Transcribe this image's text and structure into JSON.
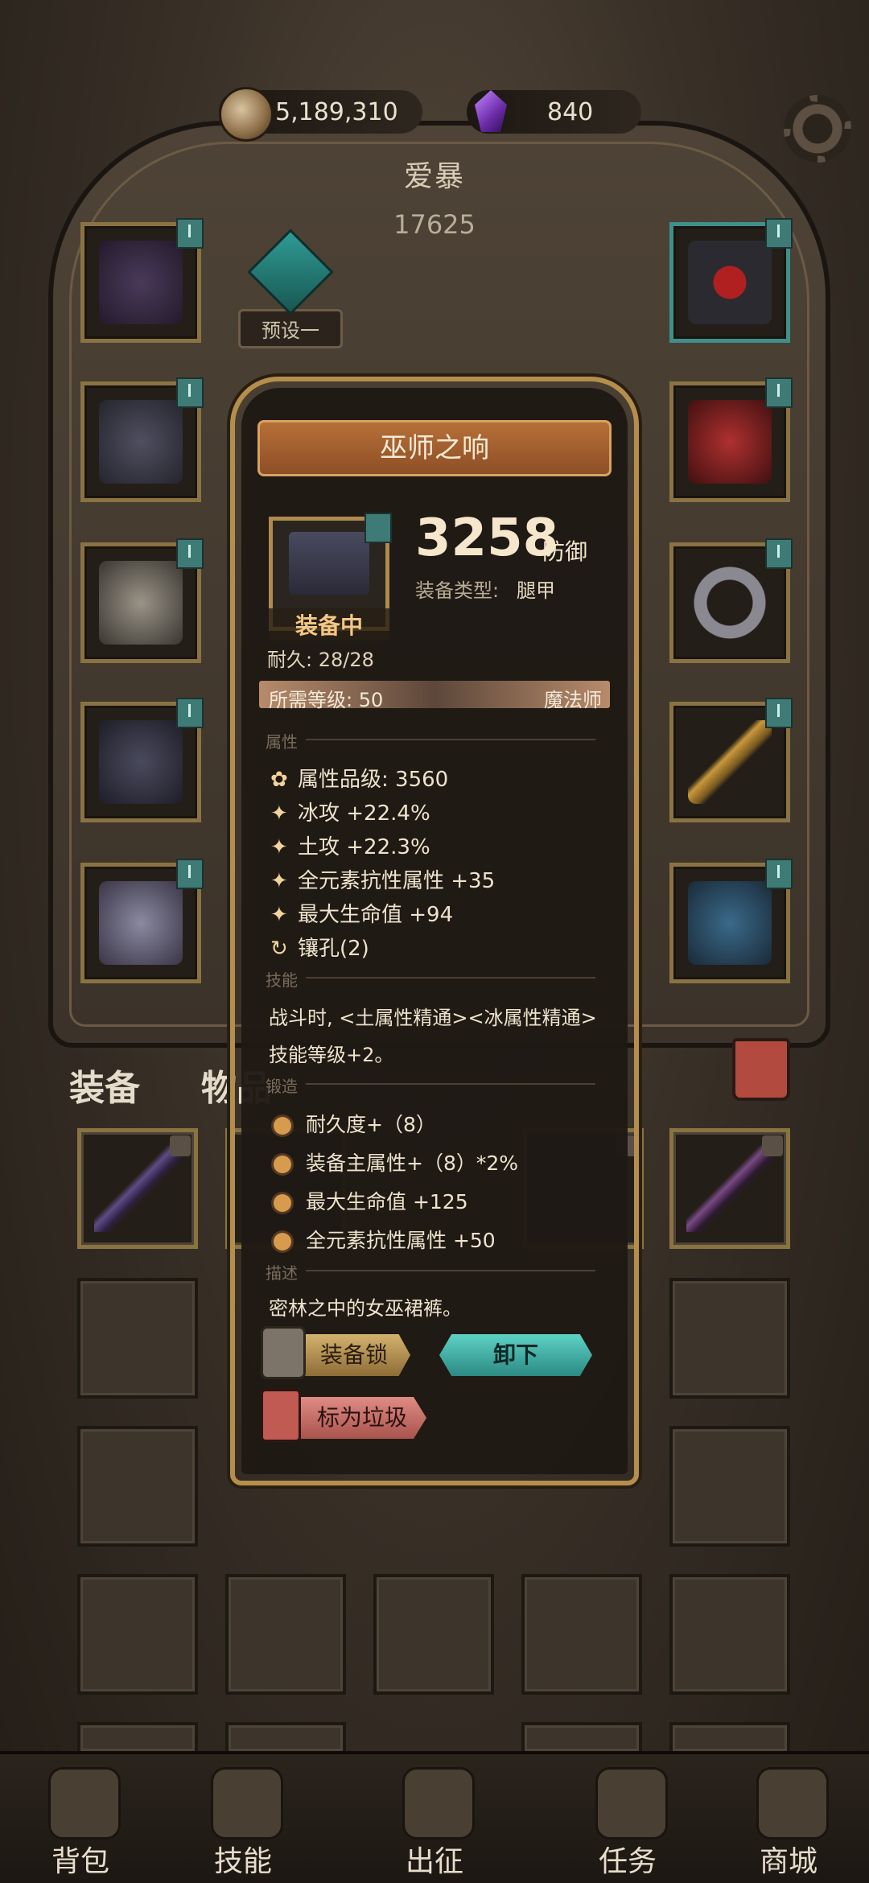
{
  "currency": {
    "gold": "5,189,310",
    "gems": "840"
  },
  "header": {
    "hero_name": "爱暴",
    "power": "17625",
    "preset_label": "预设一"
  },
  "tabs": {
    "equip": "装备",
    "items": "物品"
  },
  "dialog": {
    "title": "巫师之响",
    "equipped_label": "装备中",
    "score": "3258",
    "score_unit": "防御",
    "equip_type_label": "装备类型:",
    "equip_type_value": "腿甲",
    "durability": "耐久: 28/28",
    "required_level": "所需等级: 50",
    "required_class": "魔法师",
    "sections": {
      "attributes": "属性",
      "skill": "技能",
      "forge": "锻造",
      "description": "描述"
    },
    "attributes": [
      {
        "text": "属性品级: 3560"
      },
      {
        "text": "冰攻 +22.4%"
      },
      {
        "text": "土攻 +22.3%"
      },
      {
        "text": "全元素抗性属性 +35"
      },
      {
        "text": "最大生命值 +94"
      },
      {
        "text": "镶孔(2)"
      }
    ],
    "skill_text": "战斗时, <土属性精通><冰属性精通>技能等级+2。",
    "forge": [
      "耐久度+（8）",
      "装备主属性+（8）*2%",
      "最大生命值 +125",
      "全元素抗性属性 +50"
    ],
    "description": "密林之中的女巫裙裤。",
    "buttons": {
      "lock": "装备锁",
      "unequip": "卸下",
      "mark_trash": "标为垃圾"
    }
  },
  "nav": [
    "背包",
    "技能",
    "出征",
    "任务",
    "商城"
  ],
  "colors": {
    "gold_frame": "#8a7342",
    "teal": "#3e7b76",
    "accent_orange": "#b66f38"
  }
}
